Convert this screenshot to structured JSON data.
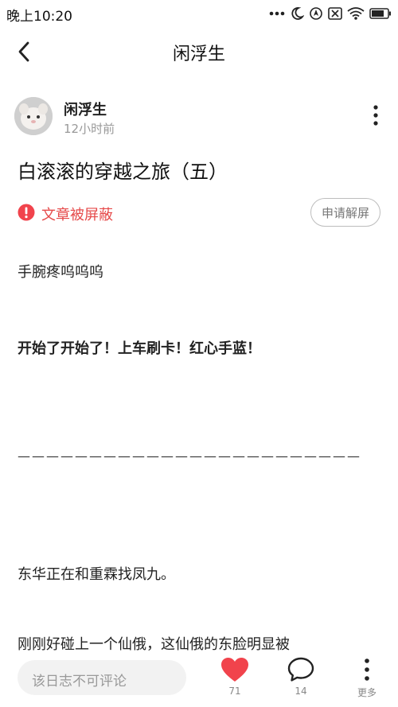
{
  "status_bar": {
    "time": "晚上10:20"
  },
  "nav": {
    "title": "闲浮生"
  },
  "author": {
    "name": "闲浮生",
    "time": "12小时前"
  },
  "post": {
    "title": "白滚滚的穿越之旅（五）",
    "blocked_text": "文章被屏蔽",
    "appeal_label": "申请解屏",
    "paragraphs": [
      "手腕疼呜呜呜",
      "开始了开始了！上车刷卡！红心手蓝！",
      "————————————————————————",
      "东华正在和重霖找凤九。",
      "刚刚好碰上一个仙俄，这仙俄的东脸明显被"
    ]
  },
  "bottom_bar": {
    "comment_placeholder": "该日志不可评论",
    "likes": "71",
    "comments": "14",
    "more_label": "更多"
  },
  "colors": {
    "accent_red": "#f1434c",
    "warning_red": "#e64a4a"
  }
}
